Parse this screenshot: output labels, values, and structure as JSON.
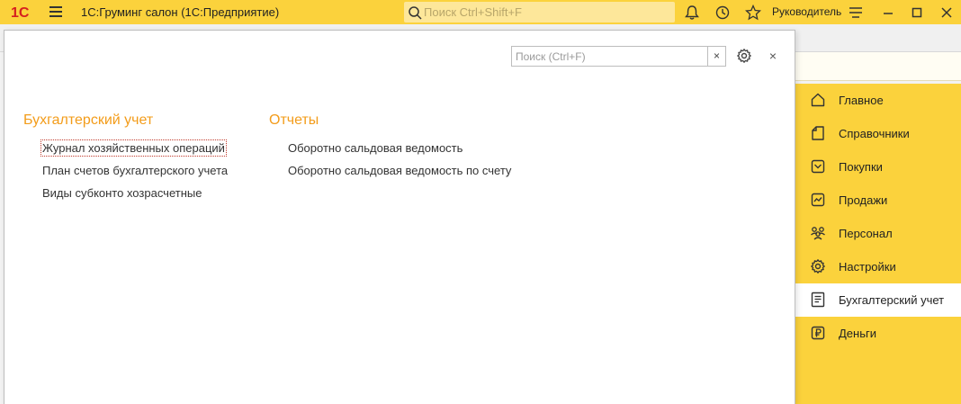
{
  "app": {
    "title": "1С:Груминг салон  (1С:Предприятие)",
    "search_placeholder": "Поиск Ctrl+Shift+F",
    "user": "Руководитель",
    "logo_icon": "1c-logo-icon"
  },
  "popup": {
    "search_placeholder": "Поиск (Ctrl+F)",
    "clear_label": "×",
    "close_label": "×",
    "columns": [
      {
        "heading": "Бухгалтерский учет",
        "links": [
          "Журнал хозяйственных операций",
          "План счетов бухгалтерского учета",
          "Виды субконто хозрасчетные"
        ]
      },
      {
        "heading": "Отчеты",
        "links": [
          "Оборотно сальдовая ведомость",
          "Оборотно сальдовая ведомость по счету"
        ]
      }
    ]
  },
  "sections": {
    "items": [
      {
        "label": "Главное",
        "icon": "home-icon"
      },
      {
        "label": "Справочники",
        "icon": "reference-icon"
      },
      {
        "label": "Покупки",
        "icon": "purchases-icon"
      },
      {
        "label": "Продажи",
        "icon": "sales-icon"
      },
      {
        "label": "Персонал",
        "icon": "people-icon"
      },
      {
        "label": "Настройки",
        "icon": "gear-icon"
      },
      {
        "label": "Бухгалтерский учет",
        "icon": "ledger-icon"
      },
      {
        "label": "Деньги",
        "icon": "ruble-icon"
      }
    ],
    "active_index": 6
  },
  "colors": {
    "accent": "#fbd23c",
    "heading": "#f39c1a"
  }
}
